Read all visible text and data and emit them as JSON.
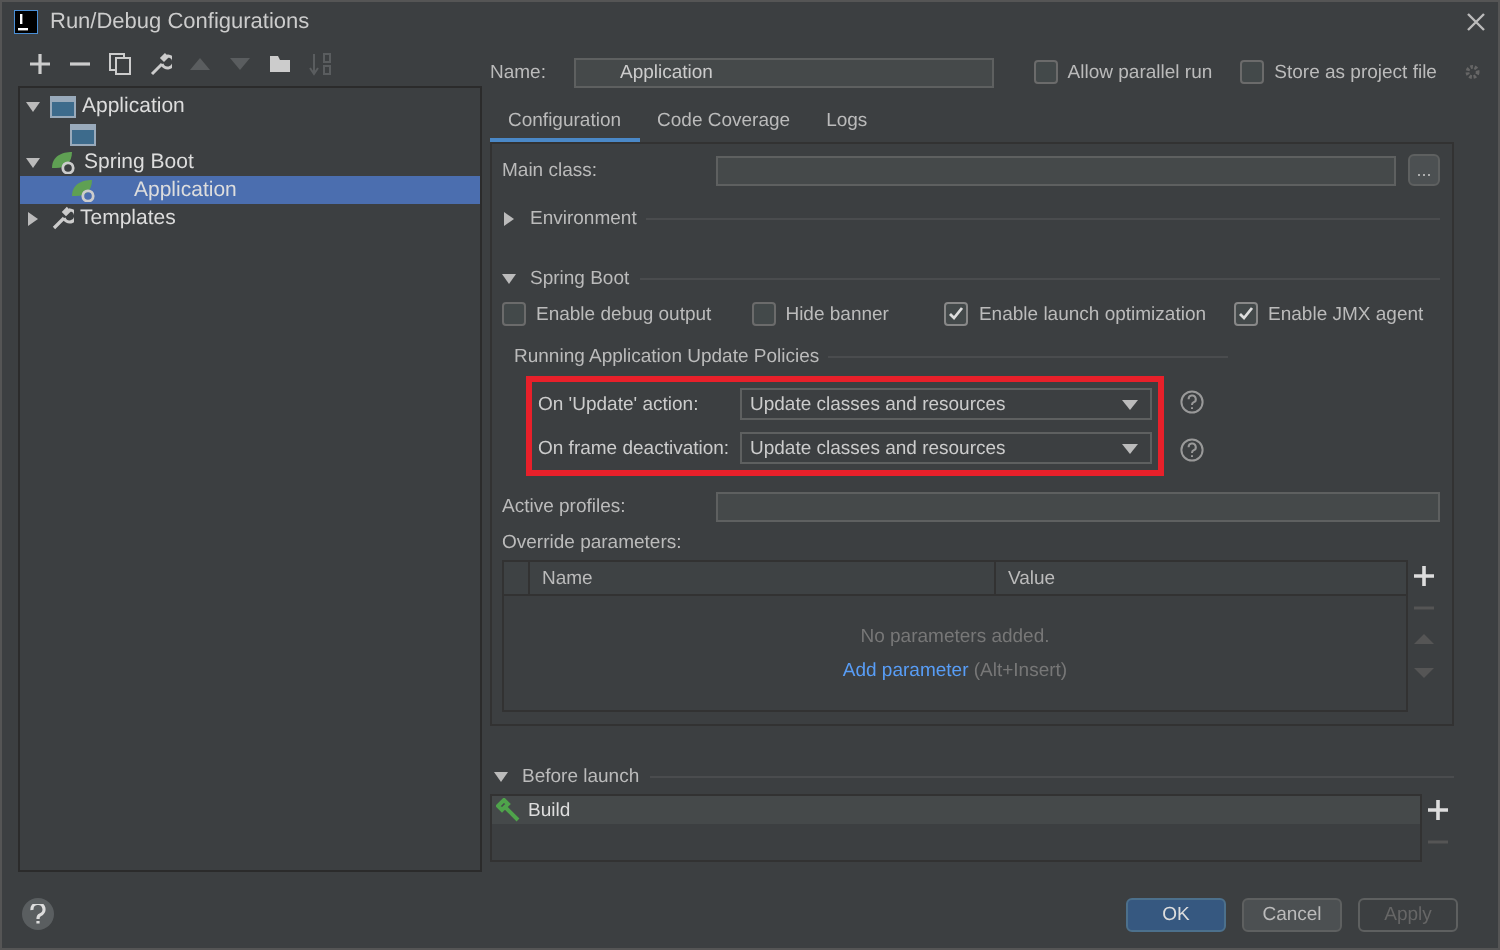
{
  "window": {
    "title": "Run/Debug Configurations"
  },
  "toolbar": [
    {
      "kind": "add",
      "disabled": false
    },
    {
      "kind": "remove",
      "disabled": false
    },
    {
      "kind": "copy",
      "disabled": false
    },
    {
      "kind": "wrench",
      "disabled": false
    },
    {
      "kind": "up",
      "disabled": true
    },
    {
      "kind": "down",
      "disabled": true
    },
    {
      "kind": "folder",
      "disabled": false
    },
    {
      "kind": "sort",
      "disabled": true
    }
  ],
  "tree": [
    {
      "label": "Application",
      "kind": "application",
      "expanded": true,
      "selected": false,
      "children": [
        {
          "kind": "application",
          "selected": false
        }
      ]
    },
    {
      "label": "Spring Boot",
      "kind": "spring",
      "expanded": true,
      "selected": false,
      "children": [
        {
          "label": "Application",
          "kind": "spring",
          "selected": true
        }
      ]
    },
    {
      "label": "Templates",
      "kind": "wrench",
      "expanded": false,
      "selected": false
    }
  ],
  "name": {
    "label": "Name:",
    "value": "Application"
  },
  "options": [
    {
      "label": "Allow parallel run",
      "checked": false
    },
    {
      "label": "Store as project file",
      "checked": false
    }
  ],
  "tabs": [
    {
      "label": "Configuration",
      "selected": true
    },
    {
      "label": "Code Coverage",
      "selected": false
    },
    {
      "label": "Logs",
      "selected": false
    }
  ],
  "main_class": {
    "label": "Main class:",
    "button": "..."
  },
  "sections": [
    {
      "label": "Environment",
      "expanded": false
    },
    {
      "label": "Spring Boot",
      "expanded": true
    }
  ],
  "checkboxes": [
    {
      "label": "Enable debug output",
      "checked": false
    },
    {
      "label": "Hide banner",
      "checked": false
    },
    {
      "label": "Enable launch optimization",
      "checked": true
    },
    {
      "label": "Enable JMX agent",
      "checked": true
    }
  ],
  "policies": {
    "title": "Running Application Update Policies",
    "highlighted": true,
    "rows": [
      {
        "label": "On 'Update' action:",
        "value": "Update classes and resources"
      },
      {
        "label": "On frame deactivation:",
        "value": "Update classes and resources"
      }
    ]
  },
  "active_profiles": {
    "label": "Active profiles:"
  },
  "override_parameters": {
    "label": "Override parameters:",
    "columns": [
      "Name",
      "Value"
    ],
    "empty_text": "No parameters added.",
    "link": "Add parameter",
    "shortcut": "(Alt+Insert)"
  },
  "before_launch": {
    "label": "Before launch",
    "expanded": true,
    "tasks": [
      "Build"
    ]
  },
  "buttons": [
    {
      "label": "OK",
      "kind": "primary",
      "disabled": false
    },
    {
      "label": "Cancel",
      "kind": "normal",
      "disabled": false
    },
    {
      "label": "Apply",
      "kind": "normal",
      "disabled": true
    }
  ]
}
